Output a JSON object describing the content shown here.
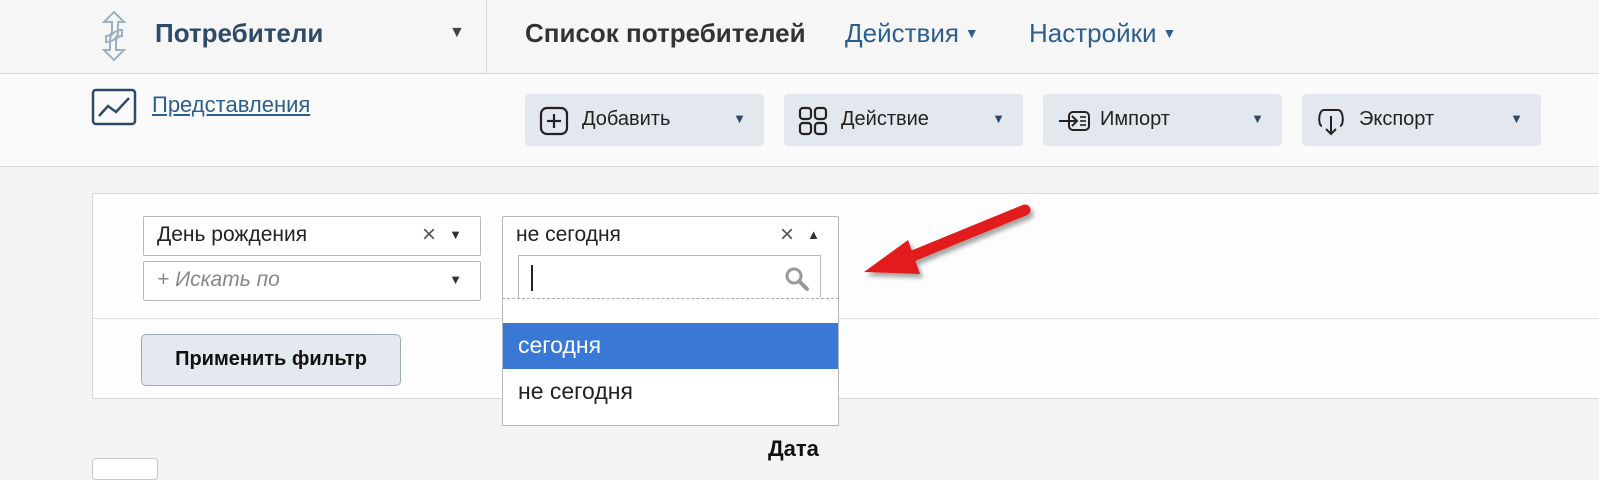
{
  "header": {
    "section_title": "Потребители",
    "page_title": "Список потребителей",
    "menus": [
      {
        "label": "Действия"
      },
      {
        "label": "Настройки"
      }
    ]
  },
  "toolbar": {
    "views_link": "Представления",
    "buttons": [
      {
        "label": "Добавить",
        "icon": "plus-square-icon"
      },
      {
        "label": "Действие",
        "icon": "grid-icon"
      },
      {
        "label": "Импорт",
        "icon": "import-icon"
      },
      {
        "label": "Экспорт",
        "icon": "export-icon"
      }
    ]
  },
  "filter": {
    "field_select": {
      "value": "День рождения"
    },
    "search_by": {
      "placeholder": "+ Искать по"
    },
    "value_select": {
      "value": "не сегодня"
    },
    "search_input": {
      "value": ""
    },
    "options": [
      {
        "label": "сегодня",
        "highlighted": true
      },
      {
        "label": "не сегодня",
        "highlighted": false
      }
    ],
    "apply_label": "Применить фильтр"
  },
  "table": {
    "column_header": "Дата"
  },
  "colors": {
    "accent": "#2d5f8c",
    "highlight": "#3a78d6",
    "arrow": "#e21a1a"
  }
}
